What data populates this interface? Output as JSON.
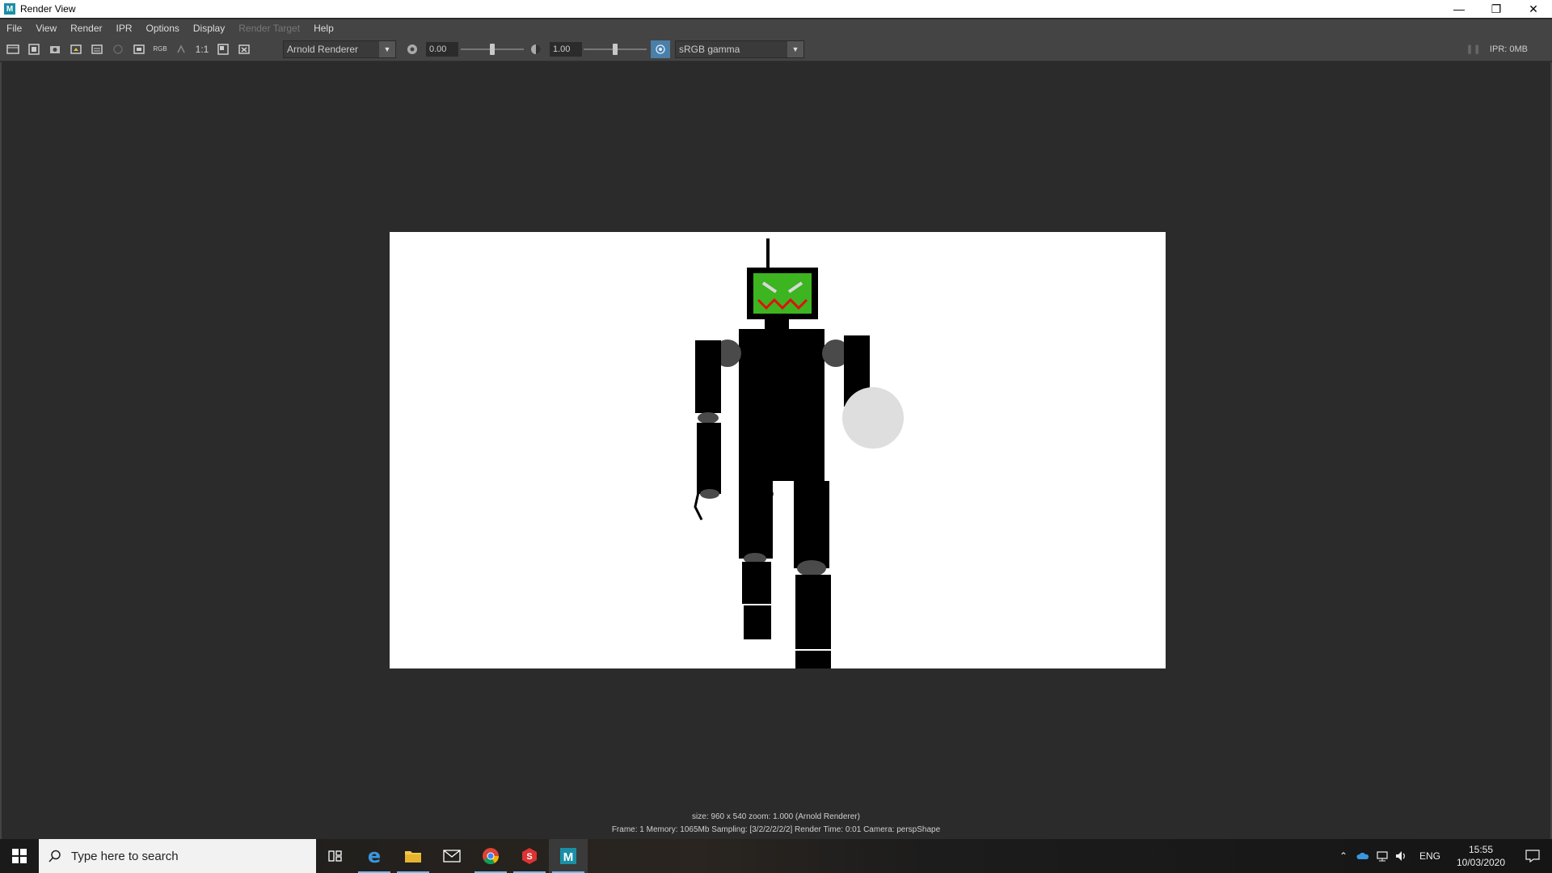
{
  "window": {
    "title": "Render View",
    "app_icon_letter": "M",
    "controls": [
      "minimize-icon",
      "restore-icon",
      "close-icon"
    ]
  },
  "menu": {
    "items": [
      {
        "label": "File",
        "enabled": true
      },
      {
        "label": "View",
        "enabled": true
      },
      {
        "label": "Render",
        "enabled": true
      },
      {
        "label": "IPR",
        "enabled": true
      },
      {
        "label": "Options",
        "enabled": true
      },
      {
        "label": "Display",
        "enabled": true
      },
      {
        "label": "Render Target",
        "enabled": false
      },
      {
        "label": "Help",
        "enabled": true
      }
    ]
  },
  "toolbar": {
    "rgb_label": "RGB",
    "one_to_one_label": "1:1",
    "renderer": "Arnold Renderer",
    "exposure_value": "0.00",
    "exposure_level": 0.5,
    "gamma_value": "1.00",
    "gamma_level": 0.5,
    "color_space": "sRGB gamma",
    "ipr_status": "IPR: 0MB"
  },
  "render_info": {
    "line1": "size: 960 x 540 zoom: 1.000     (Arnold Renderer)",
    "line2": "Frame: 1     Memory: 1065Mb     Sampling: [3/2/2/2/2/2]     Render Time: 0:01     Camera: perspShape"
  },
  "taskbar": {
    "search_placeholder": "Type here to search",
    "apps": [
      "task-view-icon",
      "edge-icon",
      "file-explorer-icon",
      "mail-icon",
      "chrome-icon",
      "substance-icon",
      "maya-icon"
    ],
    "language": "ENG",
    "time": "15:55",
    "date": "10/03/2020"
  },
  "colors": {
    "background": "#2b2b2b",
    "panel": "#444444",
    "robot_screen": "#3cb520",
    "robot_mouth": "#e01010"
  }
}
